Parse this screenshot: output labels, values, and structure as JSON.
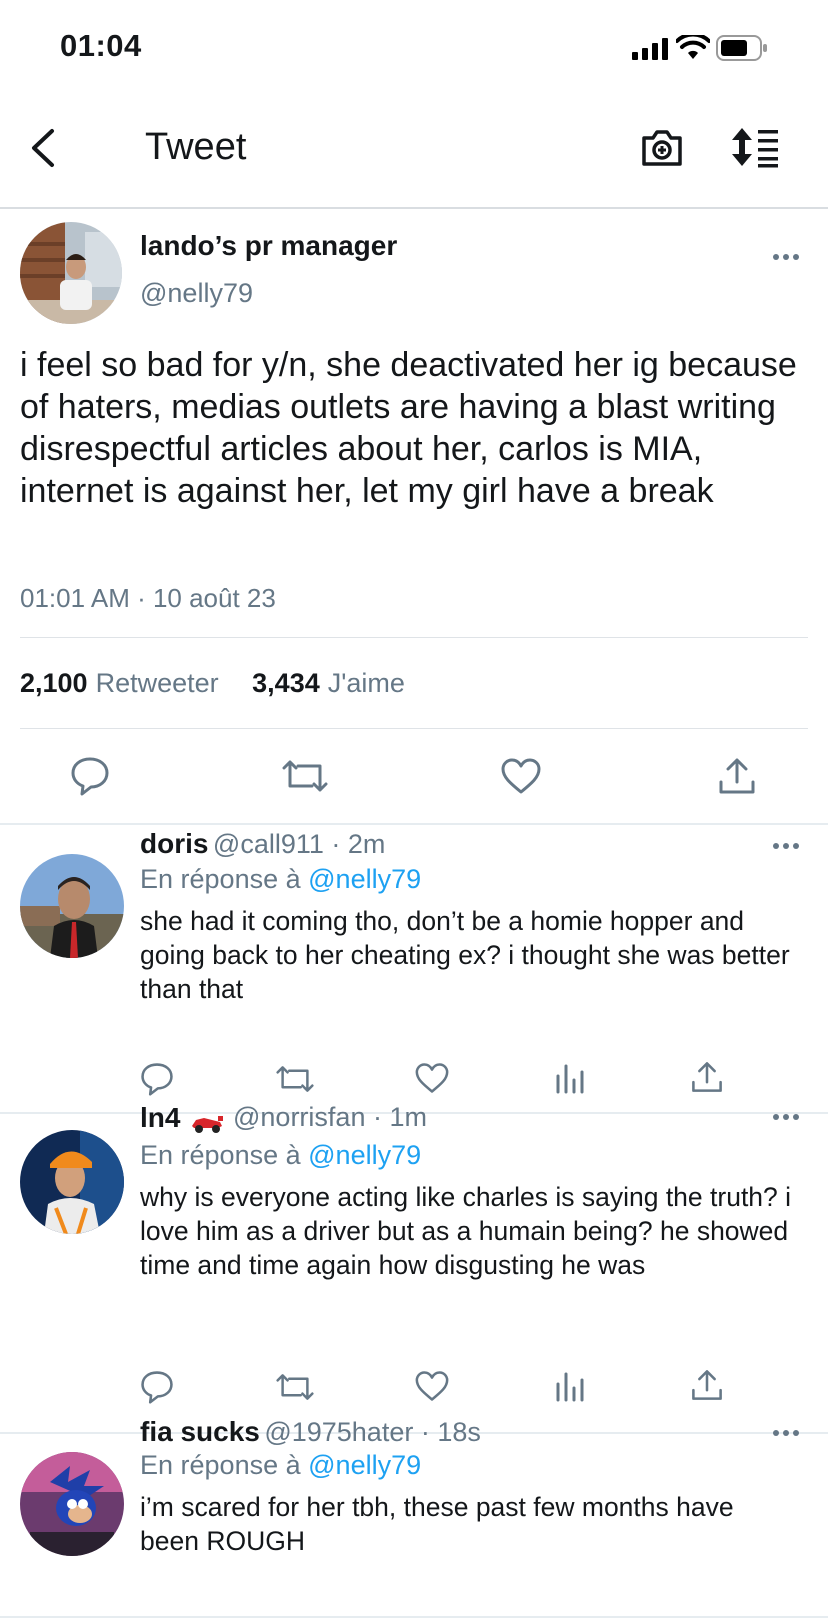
{
  "status_bar": {
    "time": "01:04"
  },
  "nav": {
    "title": "Tweet"
  },
  "main_tweet": {
    "name": "lando’s pr manager",
    "handle": "@nelly79",
    "text": "i feel so bad for y/n, she deactivated her ig because of haters, medias outlets are having a blast writing disrespectful articles about her, carlos is MIA, internet is against her, let my girl have a break",
    "timestamp": "01:01 AM · 10 août 23",
    "retweets_count": "2,100",
    "retweets_label": "Retweeter",
    "likes_count": "3,434",
    "likes_label": "J'aime"
  },
  "replies": [
    {
      "name": "doris",
      "handle_time": "@call911 · 2m",
      "in_reply_prefix": "En réponse à",
      "in_reply_handle": "@nelly79",
      "text": "she had it coming tho, don’t be a homie hopper and going back to her cheating ex? i thought she was better than that"
    },
    {
      "name": "ln4",
      "handle_time": "@norrisfan · 1m",
      "in_reply_prefix": "En réponse à",
      "in_reply_handle": "@nelly79",
      "text": "why is everyone acting like charles is saying the truth? i love him as a driver but as a humain being? he showed time and time again how disgusting he was"
    },
    {
      "name": "fia sucks",
      "handle_time": "@1975hater · 18s",
      "in_reply_prefix": "En réponse à",
      "in_reply_handle": "@nelly79",
      "text": "i’m scared for her tbh, these past few months have been ROUGH"
    }
  ],
  "icons": {
    "back": "chevron-left-icon",
    "camera": "camera-icon",
    "sort": "sort-icon",
    "more": "more-icon",
    "reply": "reply-icon",
    "retweet": "retweet-icon",
    "like": "heart-icon",
    "analytics": "analytics-icon",
    "share": "share-icon",
    "race_car": "race-car-icon"
  },
  "colors": {
    "link": "#1da1f2",
    "muted": "#657786",
    "text": "#14171a"
  }
}
